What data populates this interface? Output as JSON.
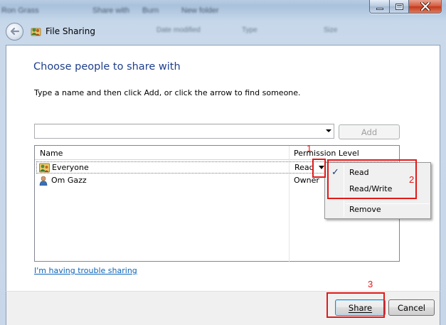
{
  "background": {
    "toolbar_items": [
      "Ron Grass",
      "Share with",
      "Burn",
      "New folder"
    ],
    "column_headers": [
      "Date modified",
      "Type",
      "Size"
    ]
  },
  "window": {
    "title": "File Sharing",
    "controls": {
      "minimize": "minimize",
      "maximize": "maximize",
      "close": "close"
    }
  },
  "dialog": {
    "heading": "Choose people to share with",
    "instruction": "Type a name and then click Add, or click the arrow to find someone.",
    "name_input": {
      "value": "",
      "placeholder": ""
    },
    "add_button": "Add",
    "columns": {
      "name": "Name",
      "permission": "Permission Level"
    },
    "rows": [
      {
        "name": "Everyone",
        "permission": "Read",
        "icon": "group-icon"
      },
      {
        "name": "Om Gazz",
        "permission": "Owner",
        "icon": "user-icon"
      }
    ],
    "trouble_link": "I'm having trouble sharing",
    "share_button": "Share",
    "cancel_button": "Cancel"
  },
  "permission_menu": {
    "items": [
      "Read",
      "Read/Write",
      "Remove"
    ],
    "checked": "Read"
  },
  "annotations": {
    "step1": "1",
    "step2": "2",
    "step3": "3",
    "color": "#e21a1a"
  },
  "colors": {
    "heading": "#1e3f8c",
    "link": "#0c64b8",
    "accent_border": "#3c7fb1"
  }
}
